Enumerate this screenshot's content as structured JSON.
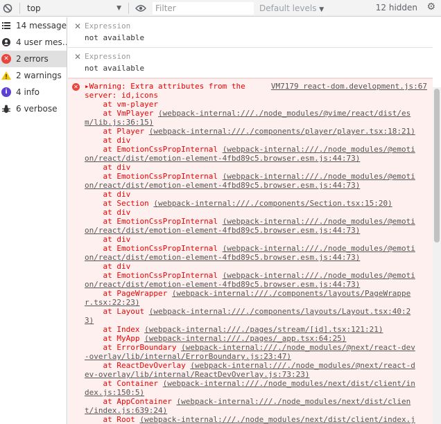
{
  "toolbar": {
    "context": "top",
    "filter_placeholder": "Filter",
    "levels": "Default levels",
    "hidden_count": "12 hidden"
  },
  "sidebar": {
    "items": [
      {
        "label": "14 messages",
        "icon": "list-icon"
      },
      {
        "label": "4 user mes…",
        "icon": "user-icon"
      },
      {
        "label": "2 errors",
        "icon": "error-icon"
      },
      {
        "label": "2 warnings",
        "icon": "warning-icon"
      },
      {
        "label": "4 info",
        "icon": "info-icon"
      },
      {
        "label": "6 verbose",
        "icon": "bug-icon"
      }
    ]
  },
  "expressions": [
    {
      "label": "Expression",
      "value": "not available"
    },
    {
      "label": "Expression",
      "value": "not available"
    }
  ],
  "error": {
    "source": "VM7179 react-dom.development.js:67",
    "lines": [
      {
        "text": "▸Warning: Extra attributes from the"
      },
      {
        "text": "server: id,icons"
      },
      {
        "text": "    at vm-player"
      },
      {
        "text": "    at VmPlayer ",
        "link": "(webpack-internal:///./node_modules/@vime/react/dist/es"
      },
      {
        "text": "",
        "link": "m/lib.js:36:15)"
      },
      {
        "text": "    at Player ",
        "link": "(webpack-internal:///./components/player/player.tsx:18:21)"
      },
      {
        "text": "    at div"
      },
      {
        "text": "    at EmotionCssPropInternal ",
        "link": "(webpack-internal:///./node_modules/@emoti"
      },
      {
        "text": "",
        "link": "on/react/dist/emotion-element-4fbd89c5.browser.esm.js:44:73)"
      },
      {
        "text": "    at div"
      },
      {
        "text": "    at EmotionCssPropInternal ",
        "link": "(webpack-internal:///./node_modules/@emoti"
      },
      {
        "text": "",
        "link": "on/react/dist/emotion-element-4fbd89c5.browser.esm.js:44:73)"
      },
      {
        "text": "    at div"
      },
      {
        "text": "    at Section ",
        "link": "(webpack-internal:///./components/Section.tsx:15:20)"
      },
      {
        "text": "    at div"
      },
      {
        "text": "    at EmotionCssPropInternal ",
        "link": "(webpack-internal:///./node_modules/@emoti"
      },
      {
        "text": "",
        "link": "on/react/dist/emotion-element-4fbd89c5.browser.esm.js:44:73)"
      },
      {
        "text": "    at div"
      },
      {
        "text": "    at EmotionCssPropInternal ",
        "link": "(webpack-internal:///./node_modules/@emoti"
      },
      {
        "text": "",
        "link": "on/react/dist/emotion-element-4fbd89c5.browser.esm.js:44:73)"
      },
      {
        "text": "    at div"
      },
      {
        "text": "    at EmotionCssPropInternal ",
        "link": "(webpack-internal:///./node_modules/@emoti"
      },
      {
        "text": "",
        "link": "on/react/dist/emotion-element-4fbd89c5.browser.esm.js:44:73)"
      },
      {
        "text": "    at PageWrapper ",
        "link": "(webpack-internal:///./components/layouts/PageWrappe"
      },
      {
        "text": "",
        "link": "r.tsx:22:23)"
      },
      {
        "text": "    at Layout ",
        "link": "(webpack-internal:///./components/layouts/Layout.tsx:40:2"
      },
      {
        "text": "",
        "link": "3)"
      },
      {
        "text": "    at Index ",
        "link": "(webpack-internal:///./pages/stream/[id].tsx:121:21)"
      },
      {
        "text": "    at MyApp ",
        "link": "(webpack-internal:///./pages/_app.tsx:64:25)"
      },
      {
        "text": "    at ErrorBoundary ",
        "link": "(webpack-internal:///./node_modules/@next/react-dev"
      },
      {
        "text": "",
        "link": "-overlay/lib/internal/ErrorBoundary.js:23:47)"
      },
      {
        "text": "    at ReactDevOverlay ",
        "link": "(webpack-internal:///./node_modules/@next/react-d"
      },
      {
        "text": "",
        "link": "ev-overlay/lib/internal/ReactDevOverlay.js:73:23)"
      },
      {
        "text": "    at Container ",
        "link": "(webpack-internal:///./node_modules/next/dist/client/in"
      },
      {
        "text": "",
        "link": "dex.js:150:5)"
      },
      {
        "text": "    at AppContainer ",
        "link": "(webpack-internal:///./node_modules/next/dist/clien"
      },
      {
        "text": "",
        "link": "t/index.js:639:24)"
      },
      {
        "text": "    at Root ",
        "link": "(webpack-internal:///./node_modules/next/dist/client/index.j"
      }
    ]
  },
  "colors": {
    "error": "#e00000",
    "error_bg": "#fff0f0",
    "warning": "#f2c500",
    "info": "#5d3fd3"
  }
}
